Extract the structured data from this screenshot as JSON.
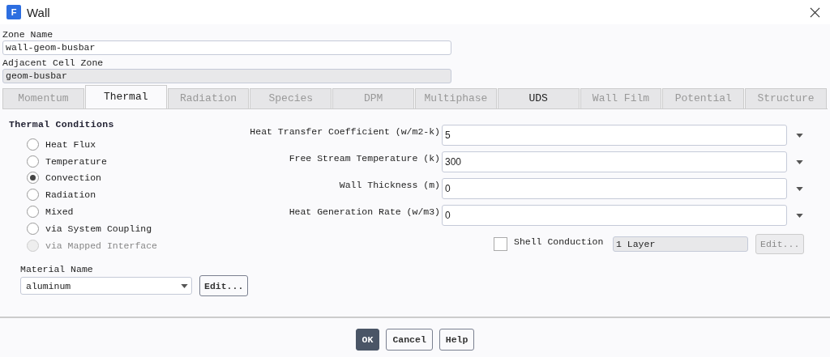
{
  "window": {
    "title": "Wall",
    "app_icon_letter": "F"
  },
  "zone_name": {
    "label": "Zone Name",
    "value": "wall-geom-busbar"
  },
  "adjacent_cell_zone": {
    "label": "Adjacent Cell Zone",
    "value": "geom-busbar"
  },
  "tabs": [
    {
      "label": "Momentum",
      "selected": false,
      "disabled": true
    },
    {
      "label": "Thermal",
      "selected": true,
      "disabled": false
    },
    {
      "label": "Radiation",
      "selected": false,
      "disabled": true
    },
    {
      "label": "Species",
      "selected": false,
      "disabled": true
    },
    {
      "label": "DPM",
      "selected": false,
      "disabled": true
    },
    {
      "label": "Multiphase",
      "selected": false,
      "disabled": true
    },
    {
      "label": "UDS",
      "selected": false,
      "disabled": false
    },
    {
      "label": "Wall Film",
      "selected": false,
      "disabled": true
    },
    {
      "label": "Potential",
      "selected": false,
      "disabled": true
    },
    {
      "label": "Structure",
      "selected": false,
      "disabled": true
    }
  ],
  "thermal_conditions": {
    "title": "Thermal Conditions",
    "options": [
      {
        "label": "Heat Flux",
        "selected": false,
        "disabled": false
      },
      {
        "label": "Temperature",
        "selected": false,
        "disabled": false
      },
      {
        "label": "Convection",
        "selected": true,
        "disabled": false
      },
      {
        "label": "Radiation",
        "selected": false,
        "disabled": false
      },
      {
        "label": "Mixed",
        "selected": false,
        "disabled": false
      },
      {
        "label": "via System Coupling",
        "selected": false,
        "disabled": false
      },
      {
        "label": "via Mapped Interface",
        "selected": false,
        "disabled": true
      }
    ]
  },
  "parameters": [
    {
      "label": "Heat Transfer Coefficient (w/m2-k)",
      "value": "5"
    },
    {
      "label": "Free Stream Temperature (k)",
      "value": "300"
    },
    {
      "label": "Wall Thickness (m)",
      "value": "0"
    },
    {
      "label": "Heat Generation Rate (w/m3)",
      "value": "0"
    }
  ],
  "shell_conduction": {
    "label": "Shell Conduction",
    "checked": false,
    "layers": "1 Layer",
    "edit_button": "Edit...",
    "edit_disabled": true
  },
  "material": {
    "label": "Material Name",
    "value": "aluminum",
    "edit_button": "Edit..."
  },
  "buttons": [
    {
      "label": "OK",
      "primary": true
    },
    {
      "label": "Cancel",
      "primary": false
    },
    {
      "label": "Help",
      "primary": false
    }
  ]
}
